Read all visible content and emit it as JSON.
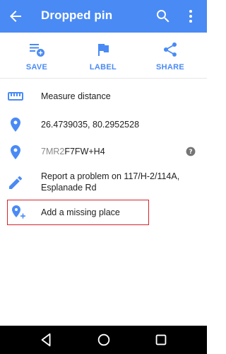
{
  "appbar": {
    "title": "Dropped pin",
    "bg_color": "#4a8af4",
    "icons": [
      "arrow-back-icon",
      "search-icon",
      "more-vert-icon"
    ]
  },
  "actions": [
    {
      "label": "SAVE",
      "icon": "playlist-add-icon"
    },
    {
      "label": "LABEL",
      "icon": "flag-icon"
    },
    {
      "label": "SHARE",
      "icon": "share-icon"
    }
  ],
  "accent_color": "#4a8af4",
  "rows": {
    "measure": {
      "text": "Measure distance",
      "icon": "ruler-icon"
    },
    "coords": {
      "text": "26.4739035, 80.2952528",
      "icon": "place-icon"
    },
    "pluscode": {
      "prefix": "7MR2",
      "code": "F7FW+H4",
      "icon": "place-icon",
      "help_icon": "help-icon"
    },
    "report": {
      "text": "Report a problem on 117/H-2/114A, Esplanade Rd",
      "icon": "pencil-icon"
    },
    "add_place": {
      "text": "Add a missing place",
      "icon": "add-location-icon",
      "highlight_color": "#d8232a"
    }
  },
  "navbar": {
    "icons": [
      "nav-back-icon",
      "nav-home-icon",
      "nav-recent-icon"
    ]
  }
}
